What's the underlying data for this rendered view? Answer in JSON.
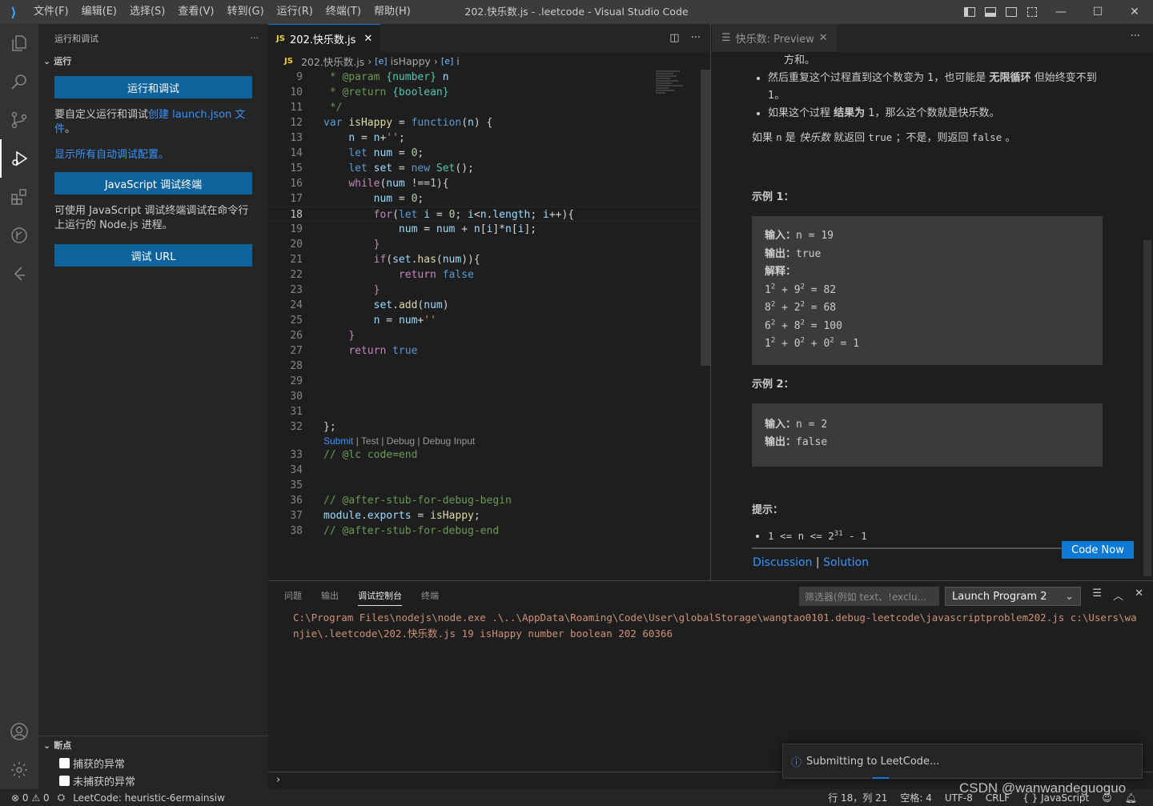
{
  "titlebar": {
    "menu": [
      "文件(F)",
      "编辑(E)",
      "选择(S)",
      "查看(V)",
      "转到(G)",
      "运行(R)",
      "终端(T)",
      "帮助(H)"
    ],
    "title": "202.快乐数.js - .leetcode - Visual Studio Code"
  },
  "sidebar": {
    "header": "运行和调试",
    "section": "运行",
    "run_debug_btn": "运行和调试",
    "custom_text": "要自定义运行和调试",
    "custom_link": "创建 launch.json 文件",
    "custom_end": "。",
    "show_all_link": "显示所有自动调试配置。",
    "js_terminal_btn": "JavaScript 调试终端",
    "js_terminal_text": "可使用 JavaScript 调试终端调试在命令行上运行的 Node.js 进程。",
    "debug_url_btn": "调试 URL",
    "breakpoints": {
      "title": "断点",
      "items": [
        "捕获的异常",
        "未捕获的异常"
      ]
    }
  },
  "editor": {
    "tab_label": "202.快乐数.js",
    "js_badge": "JS",
    "breadcrumb": {
      "file": "202.快乐数.js",
      "fn": "isHappy",
      "var": "i"
    },
    "codelens": {
      "submit": "Submit",
      "rest": " | Test | Debug | Debug Input"
    },
    "lines": [
      {
        "n": "9"
      },
      {
        "n": "10"
      },
      {
        "n": "11"
      },
      {
        "n": "12"
      },
      {
        "n": "13"
      },
      {
        "n": "14"
      },
      {
        "n": "15"
      },
      {
        "n": "16"
      },
      {
        "n": "17"
      },
      {
        "n": "18"
      },
      {
        "n": "19"
      },
      {
        "n": "20"
      },
      {
        "n": "21"
      },
      {
        "n": "22"
      },
      {
        "n": "23"
      },
      {
        "n": "24"
      },
      {
        "n": "25"
      },
      {
        "n": "26"
      },
      {
        "n": "27"
      },
      {
        "n": "28"
      },
      {
        "n": "29"
      },
      {
        "n": "30"
      },
      {
        "n": "31"
      },
      {
        "n": "32"
      },
      {
        "n": "33"
      },
      {
        "n": "34"
      },
      {
        "n": "35"
      },
      {
        "n": "36"
      },
      {
        "n": "37"
      },
      {
        "n": "38"
      }
    ]
  },
  "preview": {
    "tab_label": "快乐数: Preview",
    "b1_tail": "方和。",
    "b2_a": "然后重复这个过程直到这个数变为 1，也可能是 ",
    "b2_bold": "无限循环",
    "b2_b": " 但始终变不到 1。",
    "b3_a": "如果这个过程 ",
    "b3_bold": "结果为",
    "b3_b": " 1，那么这个数就是快乐数。",
    "p_a": "如果 ",
    "p_n": "n",
    "p_b": " 是 ",
    "p_em": "快乐数",
    "p_c": " 就返回 ",
    "p_true": "true",
    "p_d": " ；不是，则返回 ",
    "p_false": "false",
    "p_e": " 。",
    "ex1_title": "示例 1：",
    "ex2_title": "示例 2：",
    "label_in": "输入：",
    "label_out": "输出：",
    "label_explain": "解释：",
    "ex1_in": "n = 19",
    "ex1_out": "true",
    "ex2_in": "n = 2",
    "ex2_out": "false",
    "hint_title": "提示：",
    "code_now": "Code Now",
    "discussion": "Discussion",
    "solution": "Solution"
  },
  "panel": {
    "tabs": [
      "问题",
      "输出",
      "调试控制台",
      "终端"
    ],
    "filter_placeholder": "筛选器(例如 text、!exclu...",
    "launch": "Launch Program 2",
    "console_line": "C:\\Program Files\\nodejs\\node.exe .\\..\\AppData\\Roaming\\Code\\User\\globalStorage\\wangtao0101.debug-leetcode\\javascriptproblem202.js c:\\Users\\wanjie\\.leetcode\\202.快乐数.js 19 isHappy number boolean 202 60366"
  },
  "toast": {
    "text": "Submitting to LeetCode..."
  },
  "statusbar": {
    "errors": "0",
    "warnings": "0",
    "leetcode": "LeetCode: heuristic-6ermainsiw",
    "pos": "行 18，列 21",
    "spaces": "空格: 4",
    "encoding": "UTF-8",
    "eol": "CRLF",
    "lang": "{ } JavaScript"
  },
  "watermark": "CSDN @wanwandeguoguo",
  "colors": {
    "accent": "#0e639c",
    "link": "#3794ff",
    "statusbar": "#252526"
  }
}
